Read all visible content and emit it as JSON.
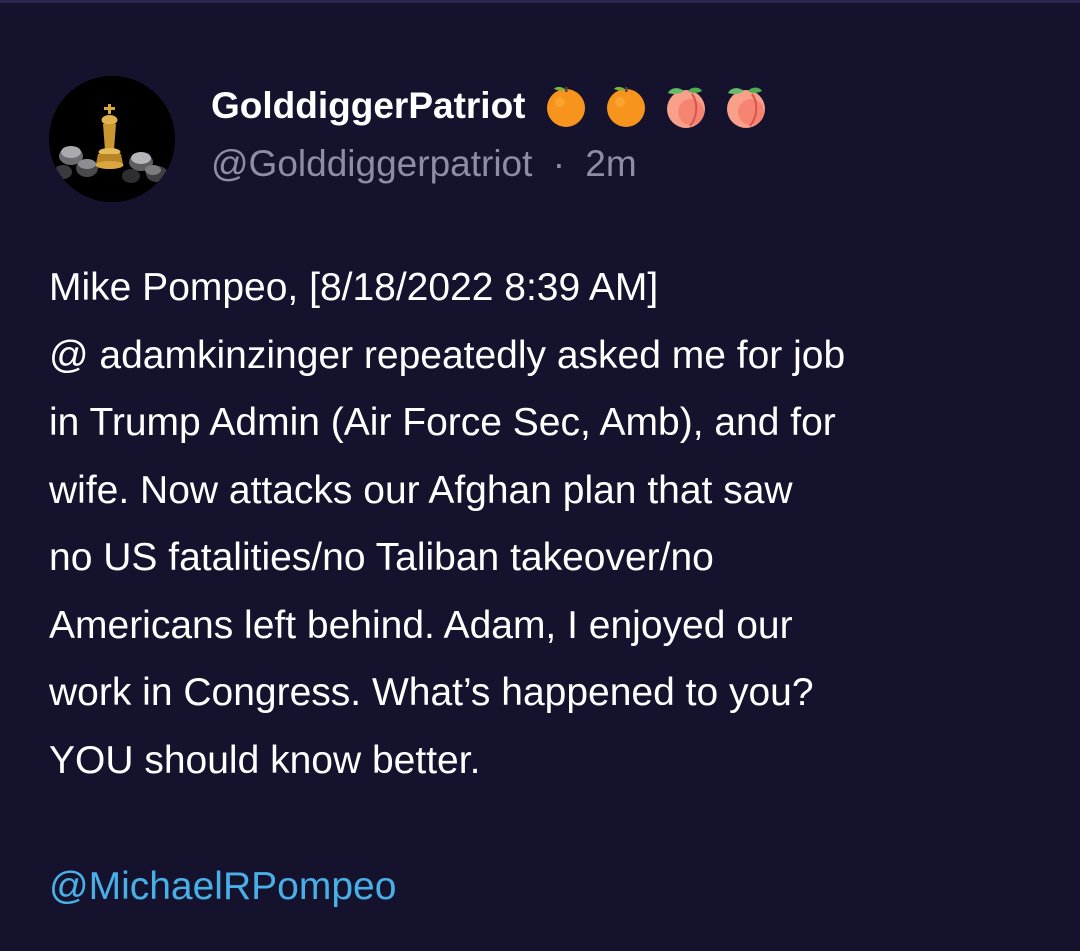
{
  "post": {
    "author": {
      "display_name": "GolddiggerPatriot",
      "handle": "@Golddiggerpatriot",
      "avatar_icon": "chess-king-avatar",
      "name_emojis": [
        "orange-icon",
        "orange-icon",
        "peach-icon",
        "peach-icon"
      ]
    },
    "separator": "·",
    "timestamp": "2m",
    "body_lines": [
      "Mike Pompeo, [8/18/2022 8:39 AM]",
      "@ adamkinzinger repeatedly asked me for job",
      "in Trump Admin (Air Force Sec, Amb), and for",
      "wife. Now attacks our Afghan plan that saw",
      "no US fatalities/no Taliban takeover/no",
      "Americans left behind. Adam, I enjoyed our",
      "work in Congress. What’s happened to you?",
      "YOU should know better."
    ],
    "mention": "@MichaelRPompeo"
  },
  "colors": {
    "background": "#15122e",
    "text": "#ffffff",
    "muted_text": "#8f8ca8",
    "link": "#48b0e6"
  }
}
